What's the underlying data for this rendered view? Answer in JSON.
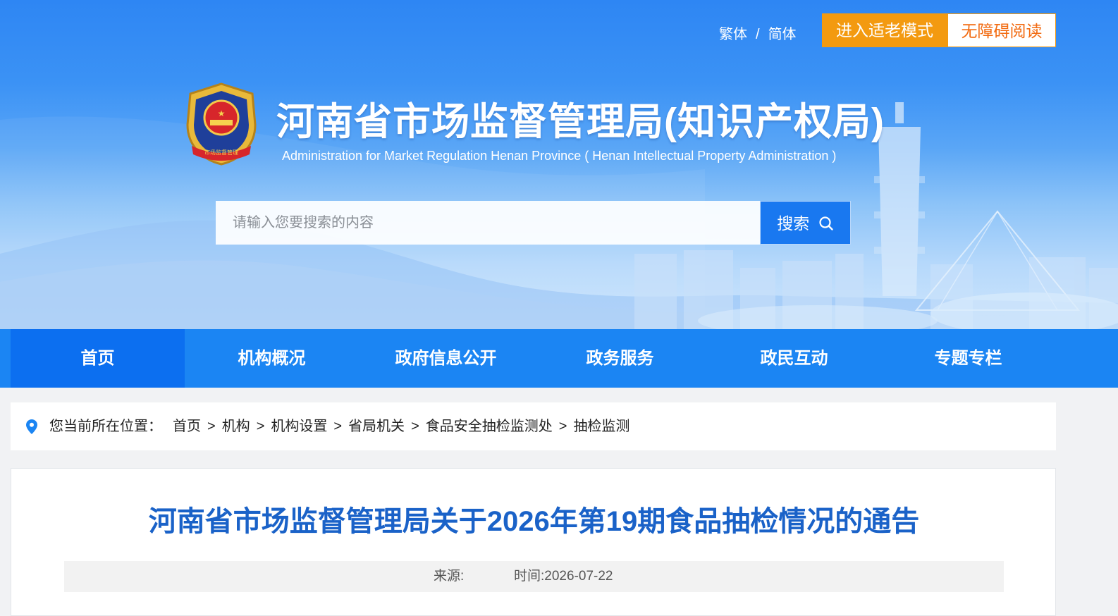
{
  "header": {
    "lang_traditional": "繁体",
    "lang_separator": "/",
    "lang_simplified": "简体",
    "elder_mode_label": "进入适老模式",
    "accessibility_label": "无障碍阅读",
    "site_title": "河南省市场监督管理局(知识产权局)",
    "site_subtitle": "Administration for  Market Regulation Henan Province ( Henan Intellectual Property  Administration )",
    "emblem_text": "市场监督管理",
    "search": {
      "placeholder": "请输入您要搜索的内容",
      "button_label": "搜索"
    }
  },
  "nav": {
    "items": [
      {
        "label": "首页"
      },
      {
        "label": "机构概况"
      },
      {
        "label": "政府信息公开"
      },
      {
        "label": "政务服务"
      },
      {
        "label": "政民互动"
      },
      {
        "label": "专题专栏"
      }
    ]
  },
  "breadcrumb": {
    "label": "您当前所在位置：",
    "items": [
      "首页",
      "机构",
      "机构设置",
      "省局机关",
      "食品安全抽检监测处",
      "抽检监测"
    ],
    "separator": ">"
  },
  "article": {
    "title": "河南省市场监督管理局关于2026年第19期食品抽检情况的通告",
    "source_label": "来源:",
    "time_label": "时间:",
    "time_value": "2026-07-22"
  },
  "colors": {
    "nav_bg": "#1b85f3",
    "nav_active": "#0c6ff0",
    "elder_button": "#f39a10",
    "title_blue": "#1a62c8",
    "search_button": "#1978f0"
  }
}
